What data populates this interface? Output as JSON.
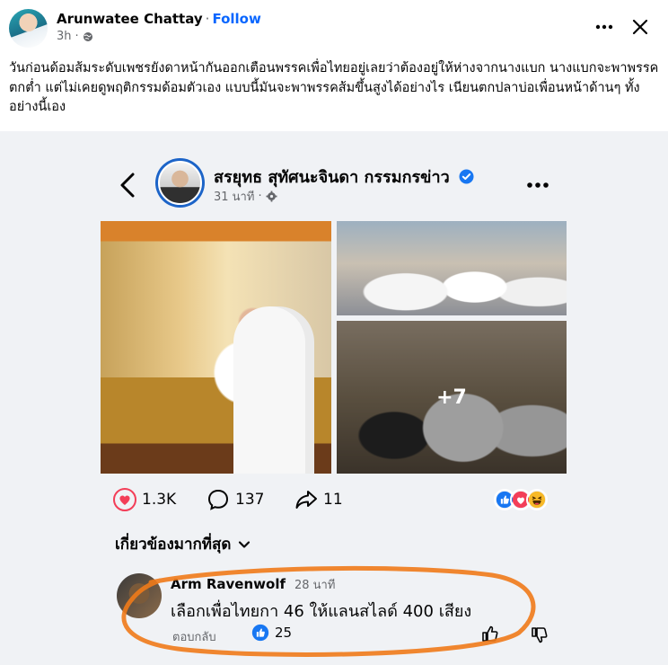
{
  "post": {
    "author": "Arunwatee Chattay",
    "separator": "·",
    "follow_label": "Follow",
    "time": "3h",
    "separator2": "·",
    "text": "วันก่อนด้อมส้มระดับเพชรยังดาหน้ากันออกเตือนพรรคเพื่อไทยอยู่เลยว่าต้องอยู่ให้ห่างจากนางแบก  นางแบกจะพาพรรคตกต่ำ  แต่ไม่เคยดูพฤติกรรมด้อมตัวเอง  แบบนี้มันจะพาพรรคส้มขึ้นสูงได้อย่างไร  เนียนตกปลาบ่อเพื่อนหน้าด้านๆ ทั้งอย่างนี้เอง"
  },
  "embedded_post": {
    "page_name": "สรยุทธ สุทัศนะจินดา กรรมกรข่าว",
    "time": "31 นาที",
    "separator": "·",
    "more_photos": "+7",
    "reactions": {
      "likes": "1.3K",
      "comments": "137",
      "shares": "11"
    },
    "sort_label": "เกี่ยวข้องมากที่สุด",
    "comment": {
      "author": "Arm Ravenwolf",
      "time": "28 นาที",
      "text": "เลือกเพื่อไทยกา 46 ให้แลนสไลด์ 400 เสียง",
      "reply_label": "ตอบกลับ",
      "likes": "25"
    }
  },
  "colors": {
    "accent": "#0866ff",
    "heart": "#f33e58",
    "highlight_ring": "#f07a1a",
    "verified": "#1877f2"
  },
  "icons": [
    "globe-icon",
    "more-icon",
    "close-icon",
    "back-icon",
    "verified-icon",
    "settings-icon",
    "heart-icon",
    "comment-icon",
    "share-icon",
    "like-icon",
    "love-icon",
    "haha-icon",
    "chevron-down-icon",
    "thumbs-up-icon",
    "thumbs-down-icon"
  ]
}
